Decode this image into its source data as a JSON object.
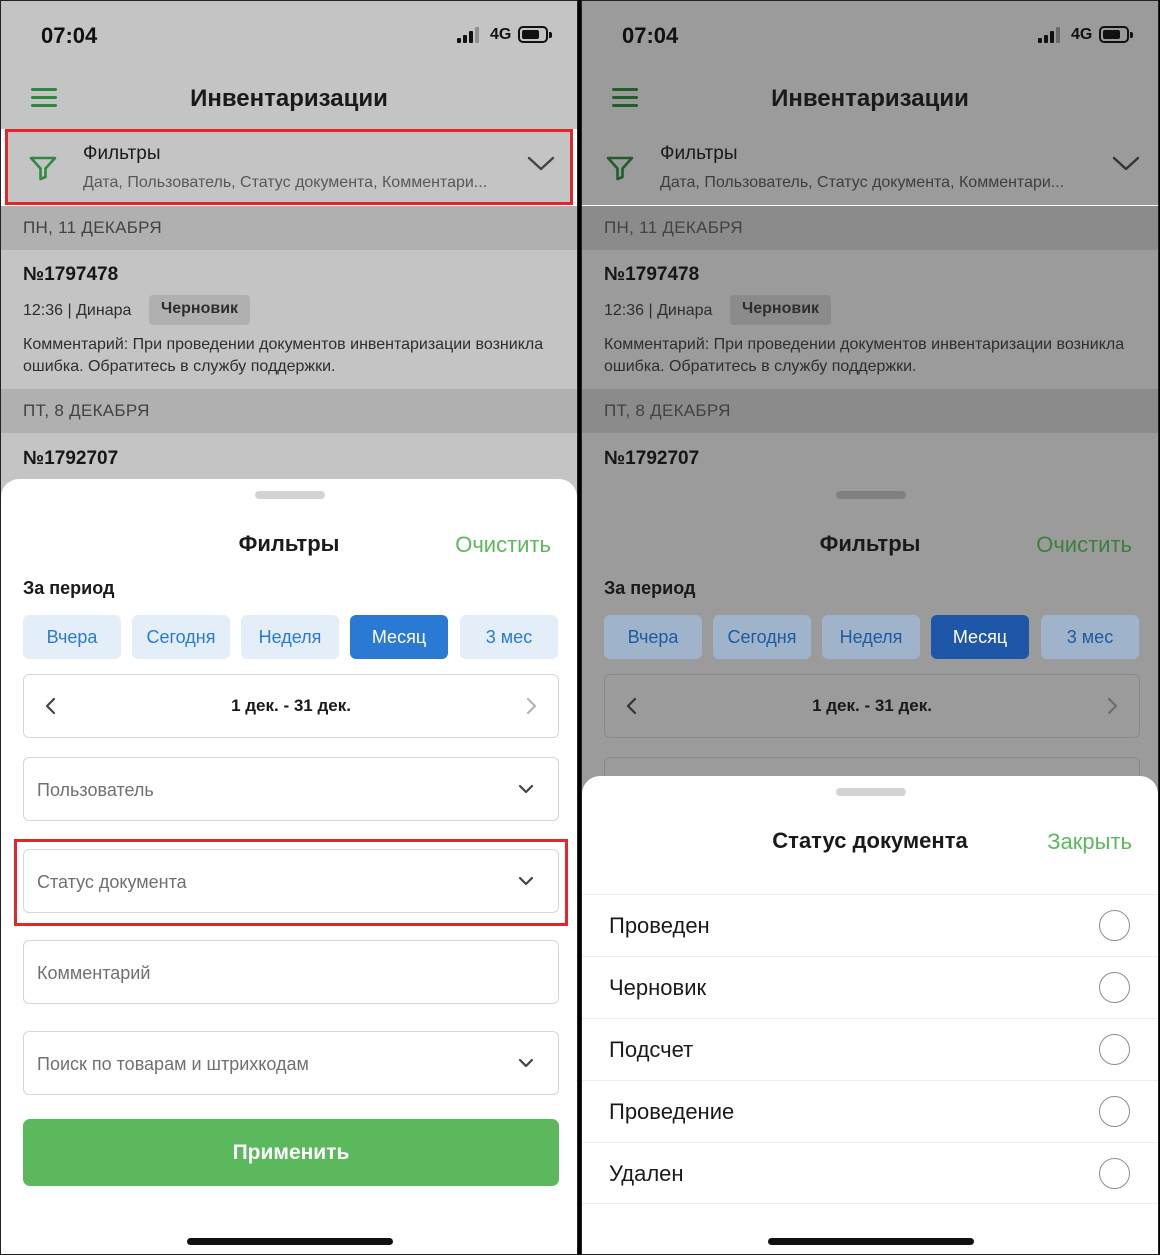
{
  "status_bar": {
    "time": "07:04",
    "network": "4G"
  },
  "app": {
    "title": "Инвентаризации",
    "filters_label": "Фильтры",
    "filters_summary": "Дата, Пользователь, Статус документа, Комментари..."
  },
  "list": {
    "sections": [
      {
        "header": "ПН, 11 ДЕКАБРЯ"
      },
      {
        "header": "ПТ, 8 ДЕКАБРЯ"
      }
    ],
    "documents": [
      {
        "number": "№1797478",
        "meta": "12:36 | Динара",
        "status": "Черновик",
        "comment": "Комментарий: При проведении документов инвентаризации возникла ошибка. Обратитесь в службу поддержки."
      },
      {
        "number": "№1792707"
      }
    ]
  },
  "filter_sheet": {
    "title": "Фильтры",
    "clear": "Очистить",
    "period_label": "За период",
    "periods": [
      "Вчера",
      "Сегодня",
      "Неделя",
      "Месяц",
      "3 мес"
    ],
    "active_period": "Месяц",
    "date_range": "1 дек. - 31 дек.",
    "user_placeholder": "Пользователь",
    "status_placeholder": "Статус документа",
    "comment_placeholder": "Комментарий",
    "search_placeholder": "Поиск по товарам и штрихкодам",
    "apply": "Применить"
  },
  "status_sheet": {
    "title": "Статус документа",
    "close": "Закрыть",
    "options": [
      "Проведен",
      "Черновик",
      "Подсчет",
      "Проведение",
      "Удален"
    ]
  },
  "colors": {
    "accent_green": "#5cb85c",
    "accent_blue": "#2a7ad3",
    "highlight_red": "#e3262b"
  }
}
